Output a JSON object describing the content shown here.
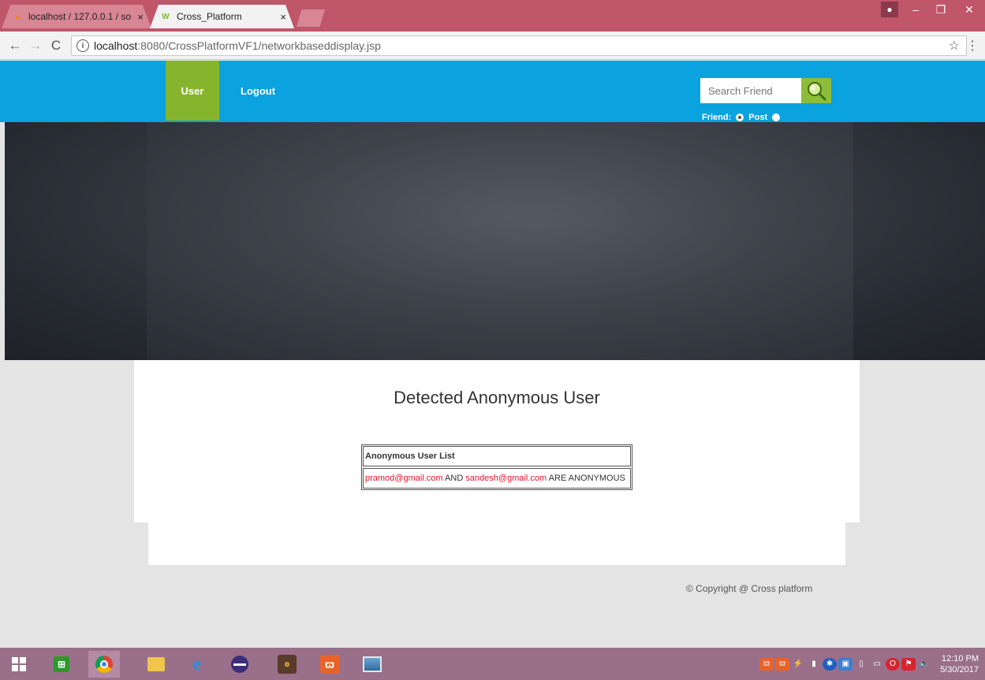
{
  "browser": {
    "tabs": [
      {
        "label": "localhost / 127.0.0.1 / so",
        "favicon": "PMA"
      },
      {
        "label": "Cross_Platform",
        "favicon": "W"
      }
    ],
    "close_glyph": "×",
    "url_host": "localhost",
    "url_path": ":8080/CrossPlatformVF1/networkbaseddisplay.jsp"
  },
  "nav": {
    "user_label": "User",
    "logout_label": "Logout"
  },
  "search": {
    "placeholder": "Search Friend",
    "friend_label": "Friend:",
    "post_label": "Post"
  },
  "main": {
    "heading": "Detected Anonymous User",
    "table_header": "Anonymous User List",
    "row": {
      "email1": "pramod@gmail.com",
      "and_text": " AND ",
      "email2": "sandesh@gmail.com",
      "suffix": " ARE ANONYMOUS"
    }
  },
  "footer": {
    "copyright": "© Copyright @ Cross platform"
  },
  "taskbar": {
    "time": "12:10 PM",
    "date": "5/30/2017"
  },
  "colors": {
    "header_blue": "#0aa2df",
    "nav_green": "#86b52d",
    "email_red": "#e0182e"
  }
}
